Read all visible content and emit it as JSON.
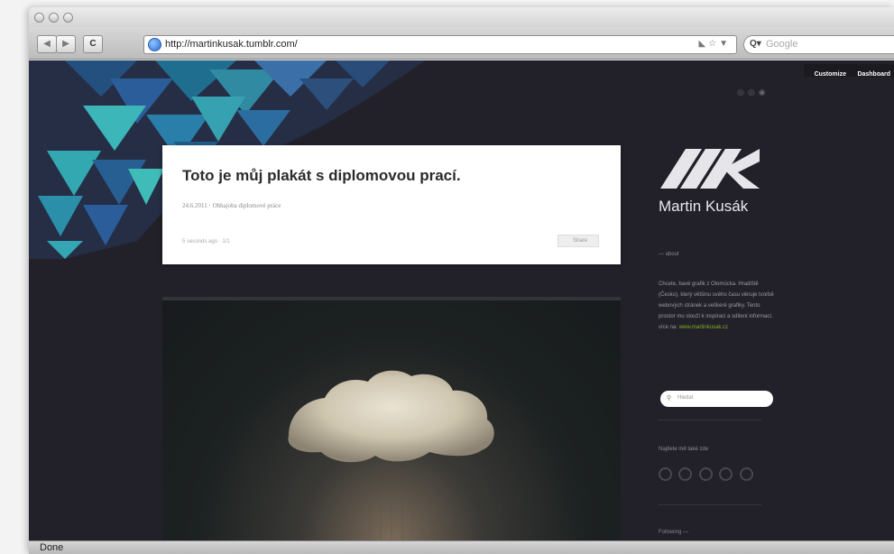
{
  "browser": {
    "url": "http://martinkusak.tumblr.com/",
    "search_placeholder": "Google",
    "search_engine_icon": "Q▾",
    "status": "Done"
  },
  "tumblr_nav": {
    "customize": "Customize",
    "dashboard": "Dashboard"
  },
  "post": {
    "title": "Toto je můj plakát s diplomovou prací.",
    "meta": "24.6.2011 · Obhajoba diplomové práce",
    "footer": "5 seconds ago · 1/1",
    "share_label": "Share"
  },
  "sidebar": {
    "brand_name": "Martin Kusák",
    "about_heading": "— about",
    "about_text": "Chcete, bavé grafik z Olomúcka. Hradiště (Česko), který většinu svého času věnuje tvorbě webových stránek a veškeré grafiky. Tento prostor mu slouží k inspiraci a sdílení informací.",
    "about_link_prefix": "více na:",
    "about_link": "www.martinkusak.cz",
    "search_placeholder": "Hledat",
    "follow_heading": "Najdete mě také zde",
    "following_heading": "Following —"
  },
  "colors": {
    "page_background": "#22212a",
    "accent_link": "#7fb21f",
    "pattern_teal": "#3cb6b9",
    "pattern_blue": "#2a5d9a"
  }
}
